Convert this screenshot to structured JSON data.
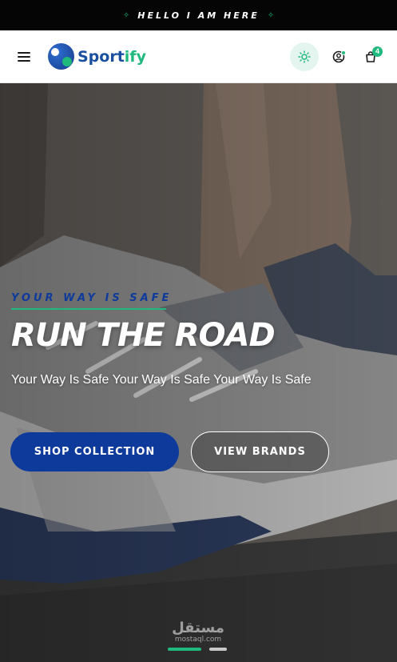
{
  "announcement": {
    "text": "HELLO I AM HERE"
  },
  "header": {
    "brand_main": "Sport",
    "brand_tail": "ify",
    "cart_count": "4",
    "icons": [
      "menu-icon",
      "logo-mark",
      "sun-icon",
      "user-icon",
      "bag-icon"
    ]
  },
  "hero": {
    "kicker": "YOUR WAY IS SAFE",
    "title": "RUN THE ROAD",
    "subtitle": "Your Way Is Safe Your Way Is Safe Your Way Is Safe",
    "primary_button": "SHOP COLLECTION",
    "secondary_button": "VIEW BRANDS",
    "slides": 2,
    "active_slide": 1
  },
  "watermark": {
    "arabic": "مستقل",
    "latin": "mostaql.com"
  },
  "colors": {
    "accent_green": "#1fb97d",
    "brand_blue": "#0d3a9b",
    "announce_bg": "#050505"
  }
}
